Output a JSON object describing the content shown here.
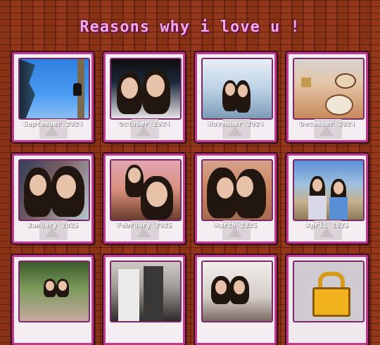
{
  "page": {
    "title": "Reasons why i love u !"
  },
  "cards": [
    {
      "label": "September 2024"
    },
    {
      "label": "October 2024"
    },
    {
      "label": "November 2024"
    },
    {
      "label": "December 2024"
    },
    {
      "label": "January 2025"
    },
    {
      "label": "February 2025"
    },
    {
      "label": "March 2025"
    },
    {
      "label": "April 2025"
    },
    {
      "label": ""
    },
    {
      "label": ""
    },
    {
      "label": ""
    },
    {
      "label": "",
      "locked": true
    }
  ],
  "colors": {
    "title": "#f6a9e2",
    "card_border": "#c23a8c",
    "background": "#7a2a12"
  }
}
